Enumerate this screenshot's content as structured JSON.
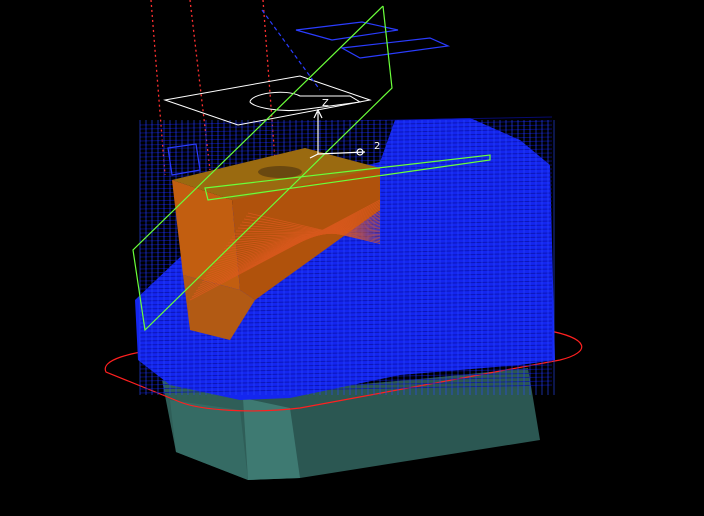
{
  "viewport": {
    "background": "#000000"
  },
  "colors": {
    "toolpath": "#1a2cff",
    "toolpath_dark": "#0d18c8",
    "part_orange": "#c25e10",
    "part_orange_light": "#d67018",
    "part_top": "#9a6a10",
    "stock_teal": "#2f5e58",
    "stock_teal_light": "#3e7a72",
    "boundary_red": "#ff2020",
    "plane_green": "#6aff3a",
    "stock_outline_white": "#ffffff",
    "tool_red_dotted": "#ff3030",
    "triad_white": "#ffffff"
  },
  "triad": {
    "z_label": "Z",
    "x_label": "2"
  }
}
